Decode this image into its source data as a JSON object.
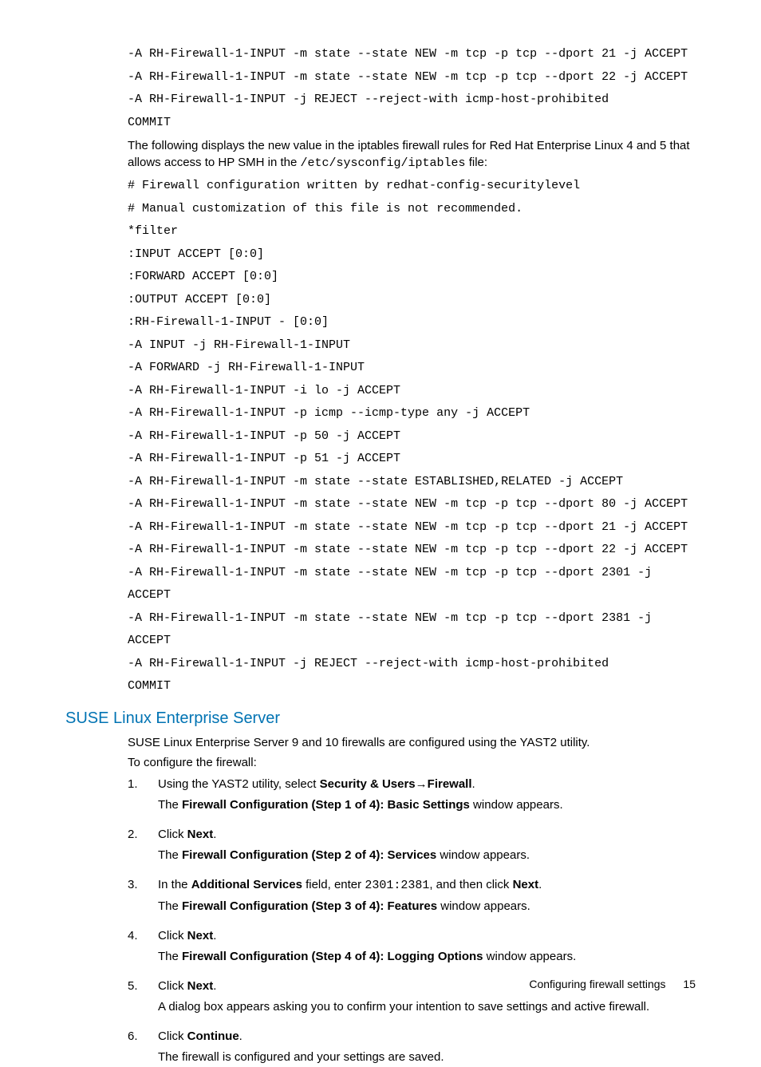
{
  "codeblock1": [
    "-A RH-Firewall-1-INPUT -m state --state NEW -m tcp -p tcp --dport 21 -j ACCEPT",
    "-A RH-Firewall-1-INPUT -m state --state NEW -m tcp -p tcp --dport 22 -j ACCEPT",
    "-A RH-Firewall-1-INPUT -j REJECT --reject-with icmp-host-prohibited",
    "COMMIT"
  ],
  "intro2_a": "The following displays the new value in the iptables firewall rules for Red Hat Enterprise Linux 4 and 5 that allows access to HP SMH in the ",
  "intro2_code": "/etc/sysconfig/iptables",
  "intro2_b": " file:",
  "codeblock2": [
    "# Firewall configuration written by redhat-config-securitylevel",
    "# Manual customization of this file is not recommended.",
    "*filter",
    ":INPUT ACCEPT [0:0]",
    ":FORWARD ACCEPT [0:0]",
    ":OUTPUT ACCEPT [0:0]",
    ":RH-Firewall-1-INPUT - [0:0]",
    "-A INPUT -j RH-Firewall-1-INPUT",
    "-A FORWARD -j RH-Firewall-1-INPUT",
    "-A RH-Firewall-1-INPUT -i lo -j ACCEPT",
    "-A RH-Firewall-1-INPUT -p icmp --icmp-type any -j ACCEPT",
    "-A RH-Firewall-1-INPUT -p 50 -j ACCEPT",
    "-A RH-Firewall-1-INPUT -p 51 -j ACCEPT",
    "-A RH-Firewall-1-INPUT -m state --state ESTABLISHED,RELATED -j ACCEPT",
    "-A RH-Firewall-1-INPUT -m state --state NEW -m tcp -p tcp --dport 80 -j ACCEPT",
    "-A RH-Firewall-1-INPUT -m state --state NEW -m tcp -p tcp --dport 21 -j ACCEPT",
    "-A RH-Firewall-1-INPUT -m state --state NEW -m tcp -p tcp --dport 22 -j ACCEPT",
    "-A RH-Firewall-1-INPUT -m state --state NEW -m tcp -p tcp --dport 2301 -j ACCEPT",
    "-A RH-Firewall-1-INPUT -m state --state NEW -m tcp -p tcp --dport 2381 -j ACCEPT",
    "-A RH-Firewall-1-INPUT -j REJECT --reject-with icmp-host-prohibited",
    "COMMIT"
  ],
  "suse_heading": "SUSE Linux Enterprise Server",
  "suse_p1": "SUSE Linux Enterprise Server 9 and 10 firewalls are configured using the YAST2 utility.",
  "suse_p2": "To configure the firewall:",
  "steps": {
    "s1a": "Using the YAST2 utility, select ",
    "s1b": "Security & Users",
    "s1arrow": "→",
    "s1c": "Firewall",
    "s1d": ".",
    "s1sub_a": "The ",
    "s1sub_b": "Firewall Configuration (Step 1 of 4): Basic Settings",
    "s1sub_c": " window appears.",
    "s2a": "Click ",
    "s2b": "Next",
    "s2c": ".",
    "s2sub_a": "The ",
    "s2sub_b": "Firewall Configuration (Step 2 of 4): Services",
    "s2sub_c": " window appears.",
    "s3a": "In the ",
    "s3b": "Additional Services",
    "s3c": " field, enter ",
    "s3code": "2301:2381",
    "s3d": ", and then click ",
    "s3e": "Next",
    "s3f": ".",
    "s3sub_a": "The ",
    "s3sub_b": "Firewall Configuration (Step 3 of 4): Features",
    "s3sub_c": " window appears.",
    "s4a": "Click ",
    "s4b": "Next",
    "s4c": ".",
    "s4sub_a": "The ",
    "s4sub_b": "Firewall Configuration (Step 4 of 4): Logging Options",
    "s4sub_c": " window appears.",
    "s5a": "Click ",
    "s5b": "Next",
    "s5c": ".",
    "s5sub": "A dialog box appears asking you to confirm your intention to save settings and active firewall.",
    "s6a": "Click ",
    "s6b": "Continue",
    "s6c": ".",
    "s6sub": "The firewall is configured and your settings are saved."
  },
  "footer": {
    "title": "Configuring firewall settings",
    "page": "15"
  }
}
